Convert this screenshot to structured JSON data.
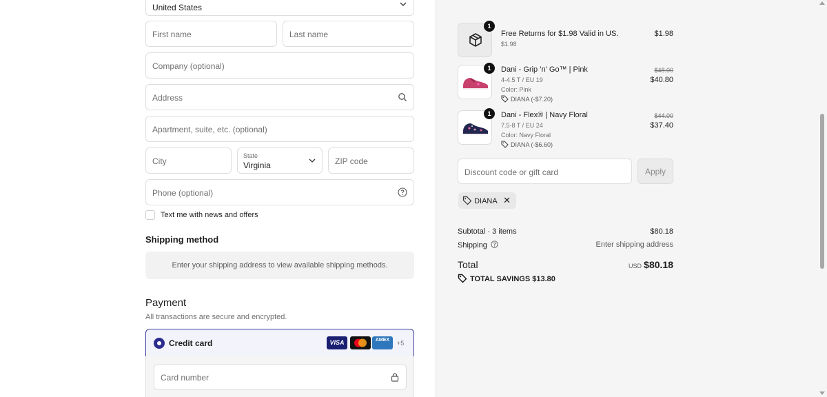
{
  "delivery": {
    "country": "United States",
    "first_name_placeholder": "First name",
    "last_name_placeholder": "Last name",
    "company_placeholder": "Company (optional)",
    "address_placeholder": "Address",
    "apartment_placeholder": "Apartment, suite, etc. (optional)",
    "city_placeholder": "City",
    "state_label": "State",
    "state_value": "Virginia",
    "zip_placeholder": "ZIP code",
    "phone_placeholder": "Phone (optional)",
    "news_label": "Text me with news and offers"
  },
  "shipping": {
    "heading": "Shipping method",
    "message": "Enter your shipping address to view available shipping methods."
  },
  "payment": {
    "heading": "Payment",
    "subtitle": "All transactions are secure and encrypted.",
    "credit_card_label": "Credit card",
    "card_logos": [
      "VISA",
      "MC",
      "AMEX"
    ],
    "more_cards": "+5",
    "card_number_placeholder": "Card number"
  },
  "cart": {
    "items": [
      {
        "qty": "1",
        "name": "Free Returns for $1.98 Valid in US.",
        "sub": "$1.98",
        "price": "$1.98",
        "icon": "box-icon"
      },
      {
        "qty": "1",
        "name": "Dani - Grip ’n’ Go™ | Pink",
        "variant": "4-4.5 T / EU 19",
        "color": "Color: Pink",
        "discount": "DIANA (-$7.20)",
        "old_price": "$48.00",
        "price": "$40.80"
      },
      {
        "qty": "1",
        "name": "Dani - Flex® | Navy Floral",
        "variant": "7.5-8 T / EU 24",
        "color": "Color: Navy Floral",
        "discount": "DIANA (-$6.60)",
        "old_price": "$44.00",
        "price": "$37.40"
      }
    ],
    "discount_placeholder": "Discount code or gift card",
    "apply_label": "Apply",
    "applied_code": "DIANA",
    "subtotal_label": "Subtotal · 3 items",
    "subtotal_value": "$80.18",
    "shipping_label": "Shipping",
    "shipping_value": "Enter shipping address",
    "total_label": "Total",
    "currency": "USD",
    "total_value": "$80.18",
    "savings": "TOTAL SAVINGS  $13.80"
  },
  "colors": {
    "accent": "#2c2c8f",
    "summary_bg": "#f5f5f5"
  }
}
